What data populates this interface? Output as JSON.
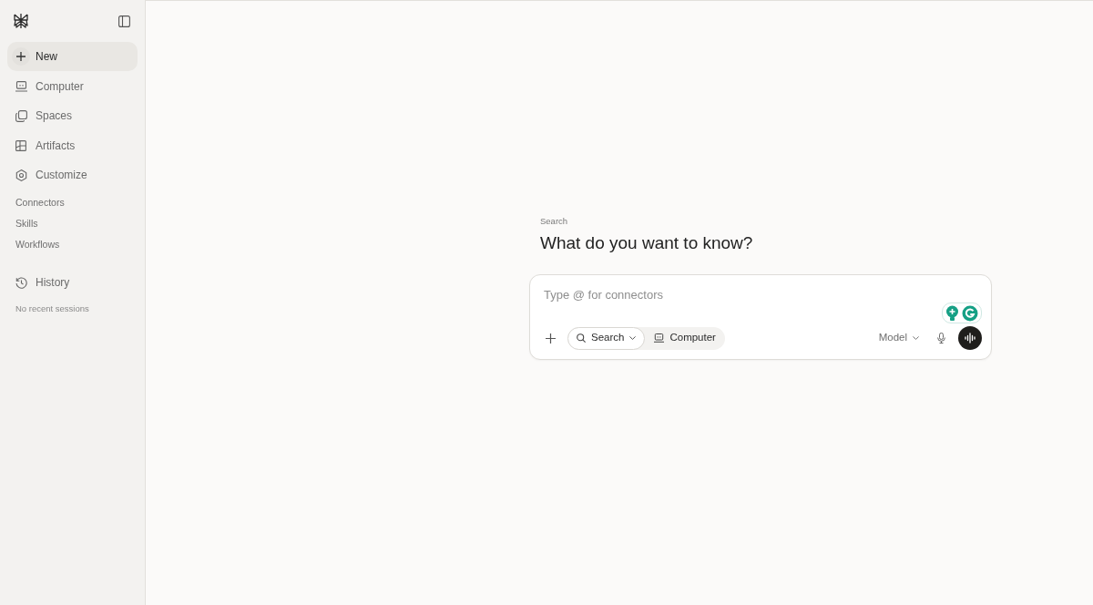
{
  "sidebar": {
    "nav_items": [
      {
        "label": "New",
        "selected": true
      },
      {
        "label": "Computer",
        "selected": false
      },
      {
        "label": "Spaces",
        "selected": false
      },
      {
        "label": "Artifacts",
        "selected": false
      },
      {
        "label": "Customize",
        "selected": false
      }
    ],
    "sub_items": [
      "Connectors",
      "Skills",
      "Workflows"
    ],
    "history": {
      "label": "History",
      "empty_text": "No recent sessions"
    }
  },
  "main": {
    "eyebrow": "Search",
    "heading": "What do you want to know?",
    "composer": {
      "placeholder": "Type @ for connectors",
      "modes": [
        {
          "label": "Search",
          "selected": true
        },
        {
          "label": "Computer",
          "selected": false
        }
      ],
      "model_label": "Model"
    }
  }
}
